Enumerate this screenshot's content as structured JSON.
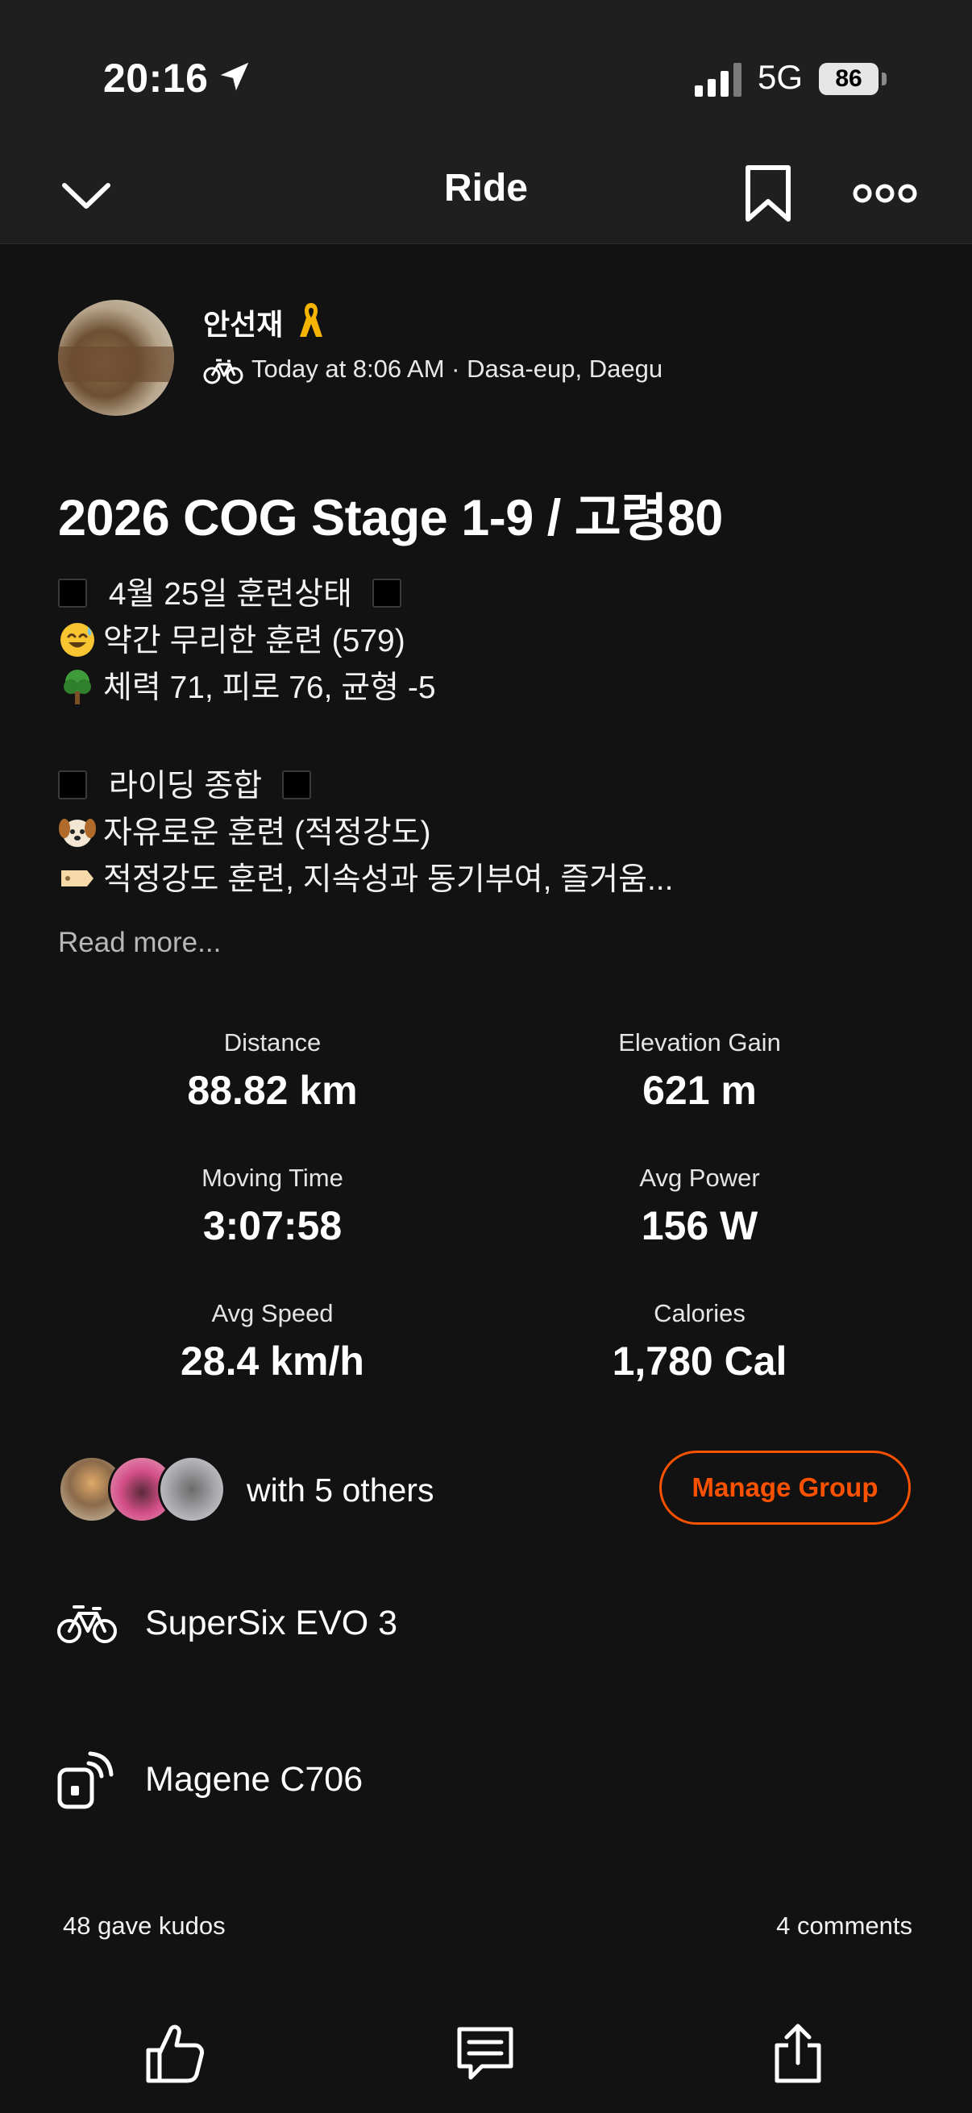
{
  "status": {
    "time": "20:16",
    "network": "5G",
    "battery": "86"
  },
  "nav": {
    "title": "Ride"
  },
  "athlete": {
    "name": "안선재",
    "meta": "Today at 8:06 AM · Dasa-eup, Daegu"
  },
  "activity": {
    "title": "2026 COG Stage 1-9 / 고령80",
    "description": {
      "line1": "4월 25일 훈련상태",
      "line2": "약간 무리한 훈련 (579)",
      "line3": "체력 71, 피로 76, 균형 -5",
      "line4": "라이딩 종합",
      "line5": "자유로운 훈련 (적정강도)",
      "line6": "적정강도 훈련, 지속성과 동기부여, 즐거움..."
    },
    "read_more": "Read more..."
  },
  "stats": {
    "distance_label": "Distance",
    "distance": "88.82 km",
    "elevation_label": "Elevation Gain",
    "elevation": "621 m",
    "moving_time_label": "Moving Time",
    "moving_time": "3:07:58",
    "avg_power_label": "Avg Power",
    "avg_power": "156 W",
    "avg_speed_label": "Avg Speed",
    "avg_speed": "28.4 km/h",
    "calories_label": "Calories",
    "calories": "1,780 Cal"
  },
  "group": {
    "text": "with 5 others",
    "button": "Manage Group"
  },
  "gear": {
    "bike": "SuperSix EVO 3",
    "device": "Magene C706"
  },
  "social": {
    "kudos": "48 gave kudos",
    "comments": "4 comments"
  },
  "colors": {
    "accent": "#fc5200",
    "background": "#121212",
    "header": "#1f1f1f"
  },
  "icons": [
    "location-arrow-icon",
    "signal-icon",
    "battery-icon",
    "chevron-down-icon",
    "bookmark-icon",
    "more-icon",
    "yellow-ribbon-icon",
    "bike-icon",
    "device-icon",
    "thumbs-up-icon",
    "comment-icon",
    "share-icon"
  ]
}
